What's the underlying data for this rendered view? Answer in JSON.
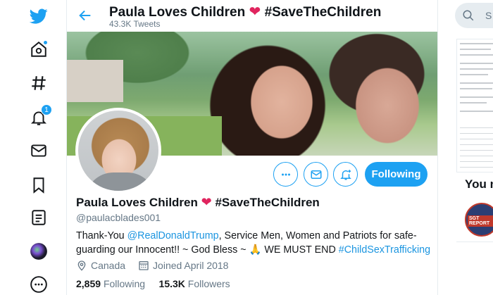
{
  "header": {
    "title": "Paula Loves Children",
    "title_heart": "❤",
    "title_tag": "#SaveTheChildren",
    "tweets_count": "43.3K Tweets"
  },
  "nav": {
    "notifications_badge": "1"
  },
  "profile": {
    "name": "Paula Loves Children",
    "name_heart": "❤",
    "name_tag": "#SaveTheChildren",
    "handle": "@paulacblades001",
    "bio": {
      "part1": "Thank-You ",
      "mention": "@RealDonaldTrump",
      "part2": ", Service Men, Women and Patriots for safe-guarding our Innocent!! ~ God Bless ~ 🙏 WE MUST END ",
      "hashtag": "#ChildSexTrafficking"
    },
    "location": "Canada",
    "joined": "Joined April 2018",
    "following_count": "2,859",
    "following_label": "Following",
    "followers_count": "15.3K",
    "followers_label": "Followers"
  },
  "actions": {
    "follow_label": "Following"
  },
  "right": {
    "search_placeholder": "S",
    "you_heading": "You m",
    "sgt_label": "SGT REPORT"
  },
  "colors": {
    "accent": "#1da1f2",
    "link": "#1b95e0",
    "heart": "#e0245e",
    "muted": "#657786"
  }
}
